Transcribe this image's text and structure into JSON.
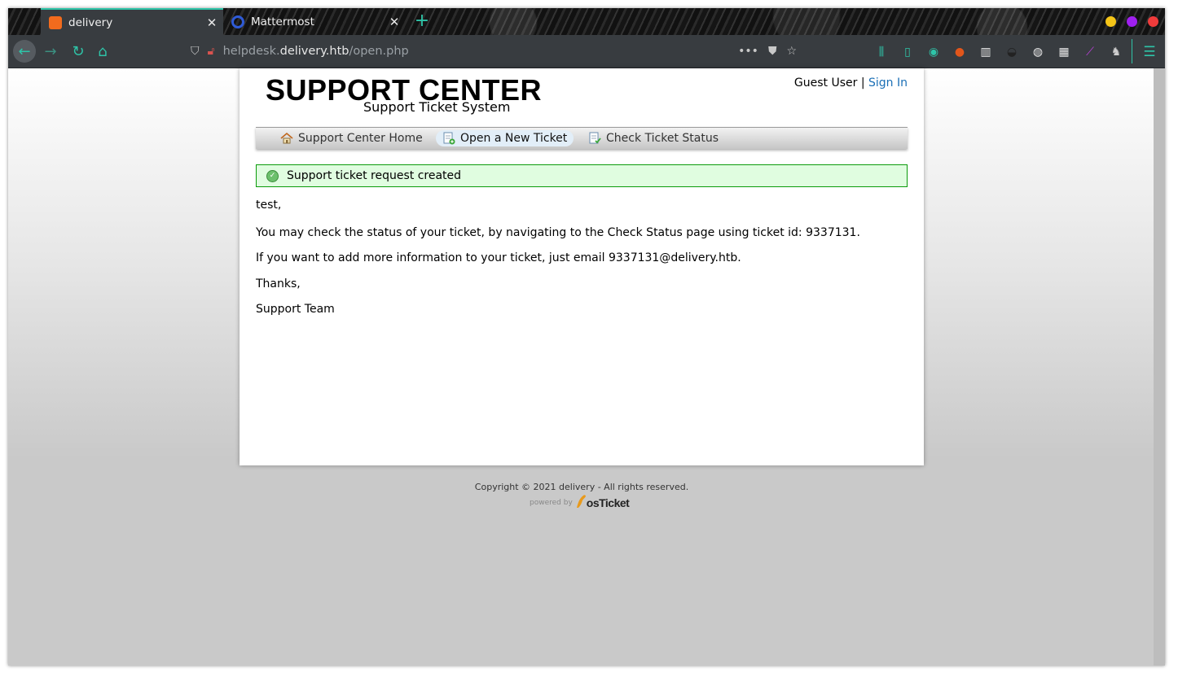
{
  "browser": {
    "tabs": [
      {
        "title": "delivery",
        "favicon": "osticket-favicon",
        "active": true
      },
      {
        "title": "Mattermost",
        "favicon": "mattermost-favicon",
        "active": false
      }
    ],
    "url": {
      "prefix": "helpdesk.",
      "domain": "delivery.htb",
      "path": "/open.php"
    },
    "accent": "#2ec4a8",
    "window_controls": [
      "#f5c518",
      "#a020f0",
      "#ef3b3b"
    ]
  },
  "page": {
    "logo": {
      "title": "SUPPORT CENTER",
      "subtitle": "Support Ticket System"
    },
    "user": {
      "name": "Guest User",
      "separator": "|",
      "sign_in": "Sign In"
    },
    "nav": [
      {
        "label": "Support Center Home",
        "icon": "home-icon"
      },
      {
        "label": "Open a New Ticket",
        "icon": "new-ticket-icon",
        "active": true
      },
      {
        "label": "Check Ticket Status",
        "icon": "ticket-status-icon"
      }
    ],
    "alert": "Support ticket request created",
    "message": {
      "greeting": "test,",
      "line1": "You may check the status of your ticket, by navigating to the Check Status page using ticket id: 9337131.",
      "line2": "If you want to add more information to your ticket, just email 9337131@delivery.htb.",
      "thanks": "Thanks,",
      "signature": "Support Team"
    },
    "footer": {
      "copyright": "Copyright © 2021 delivery - All rights reserved.",
      "powered_by": "powered by",
      "brand": "osTicket"
    }
  }
}
